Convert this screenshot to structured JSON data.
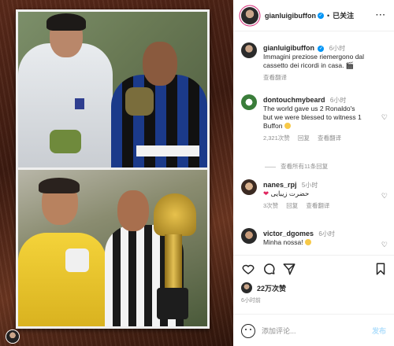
{
  "post": {
    "username": "gianluigibuffon",
    "follow_label": "已关注",
    "caption_time": "6小时",
    "caption_line1": "Immagini preziose riemergono dal",
    "caption_line2": "cassetto dei ricordi in casa.",
    "caption_translate": "查看翻译",
    "likes": "22万次赞",
    "posted_time": "6小时前",
    "comment_placeholder": "添加评论...",
    "post_button": "发布"
  },
  "comments": [
    {
      "username": "dontouchmybeard",
      "time": "6小时",
      "line1": "The world gave us 2 Ronaldo's",
      "line2": "but we were blessed to witness 1",
      "line3": "Buffon",
      "likes": "2,321次赞",
      "reply": "回复",
      "translate": "查看翻译",
      "replies": "查看所有11条回复"
    },
    {
      "username": "nanes_rpj",
      "time": "5小时",
      "text": "حضرت زيبايى",
      "likes": "3次赞",
      "reply": "回复",
      "translate": "查看翻译"
    },
    {
      "username": "victor_dgomes",
      "time": "6小时",
      "text": "Minha nossa!"
    }
  ],
  "icons": {
    "more": "more-options-icon",
    "like": "heart-icon",
    "comment": "comment-icon",
    "share": "send-icon",
    "save": "bookmark-icon",
    "emoji": "emoji-icon"
  },
  "colors": {
    "verified": "#0095f6",
    "link_blue": "#b2dffc",
    "story_ring": "#d62976",
    "muted": "#8e8e8e"
  }
}
